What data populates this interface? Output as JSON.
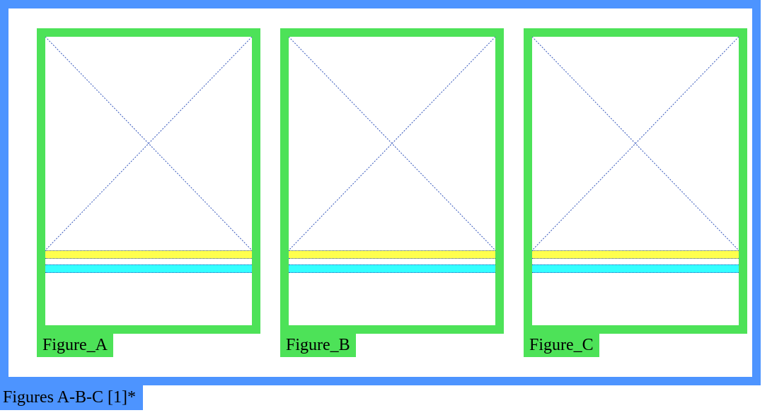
{
  "outer_label": "Figures A-B-C [1]*",
  "colors": {
    "outer_border": "#4d94ff",
    "figure_border": "#4de258",
    "yellow_bar": "#ffff4d",
    "cyan_bar": "#33ffff",
    "diagonal_line": "#3355bb"
  },
  "figures": [
    {
      "label": "Figure_A"
    },
    {
      "label": "Figure_B"
    },
    {
      "label": "Figure_C"
    }
  ],
  "bar_positions": {
    "yellow_top_pct": 74,
    "cyan_top_pct": 79,
    "diagonal_bottom_pct": 74
  }
}
